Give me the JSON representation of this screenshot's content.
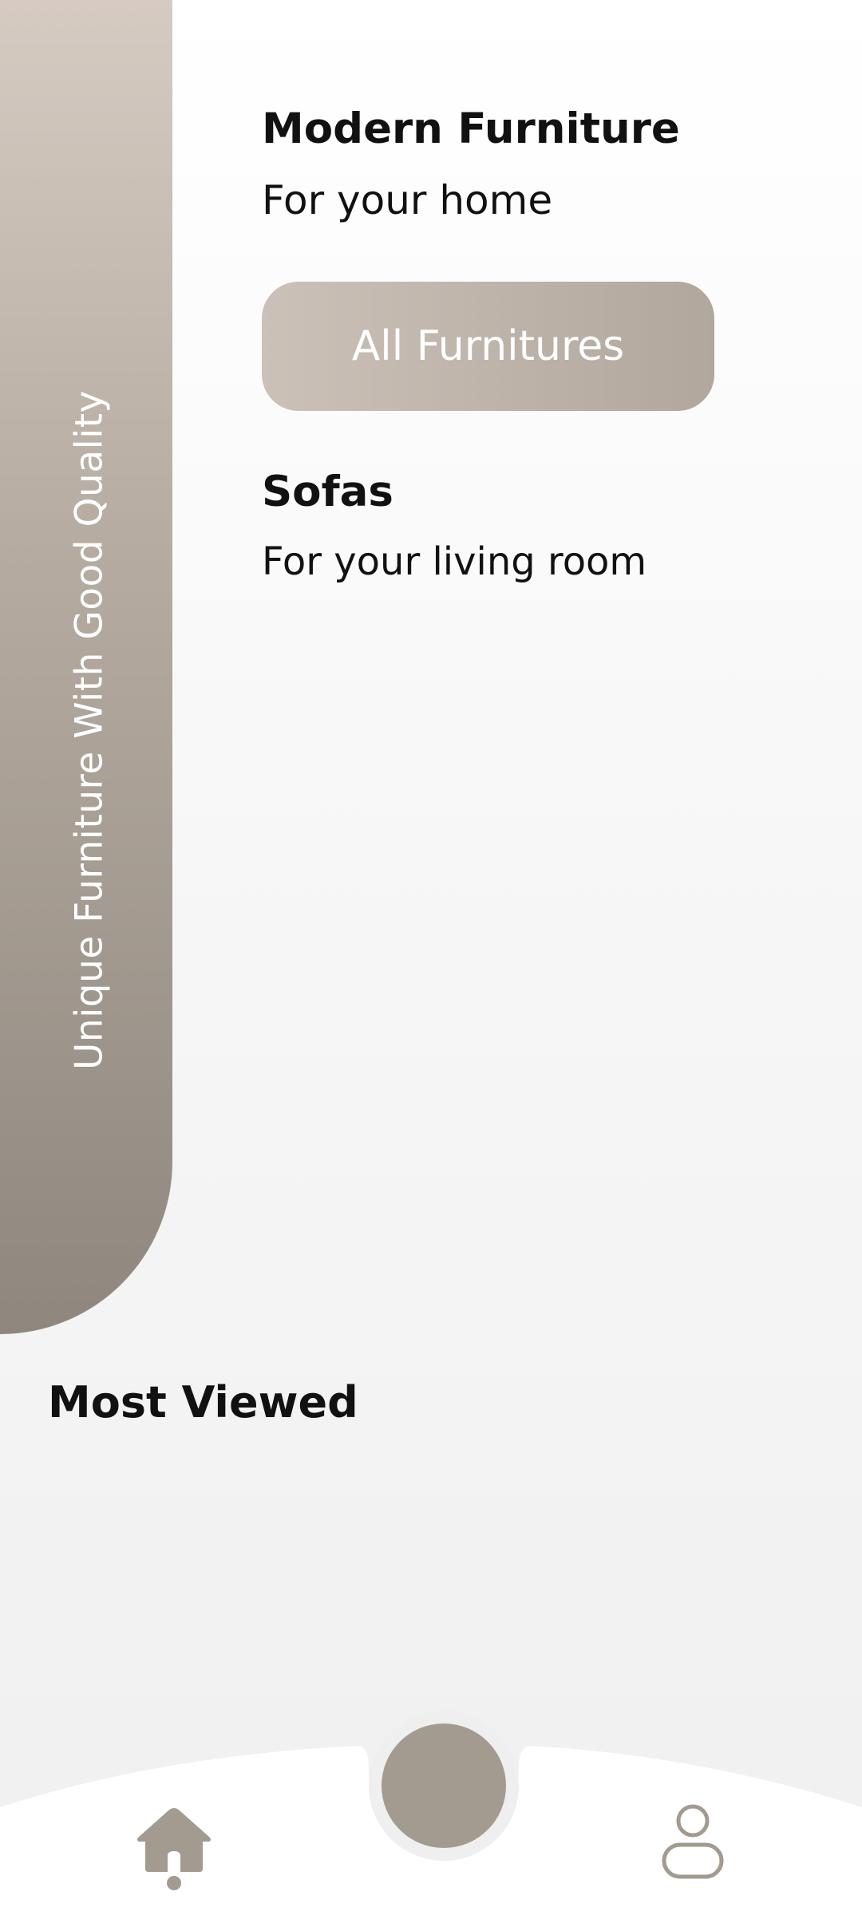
{
  "banner": {
    "tagline": "Unique Furniture With Good Quality"
  },
  "header": {
    "title": "Modern Furniture",
    "subtitle": "For your home"
  },
  "cta": {
    "label": "All Furnitures"
  },
  "category": {
    "title": "Sofas",
    "subtitle": "For your living room"
  },
  "sections": {
    "most_viewed": "Most Viewed"
  },
  "bottom_nav": {
    "items": [
      {
        "icon": "home-icon",
        "active": true
      },
      {
        "icon": "center-action",
        "active": false
      },
      {
        "icon": "profile-icon",
        "active": false
      }
    ]
  },
  "colors": {
    "accent": "#a39a90",
    "banner_top": "#d6cbc2",
    "banner_bottom": "#8f877e",
    "button_start": "#cbc1b8",
    "button_end": "#b1a79d",
    "text": "#111111",
    "on_accent_text": "#ffffff"
  }
}
